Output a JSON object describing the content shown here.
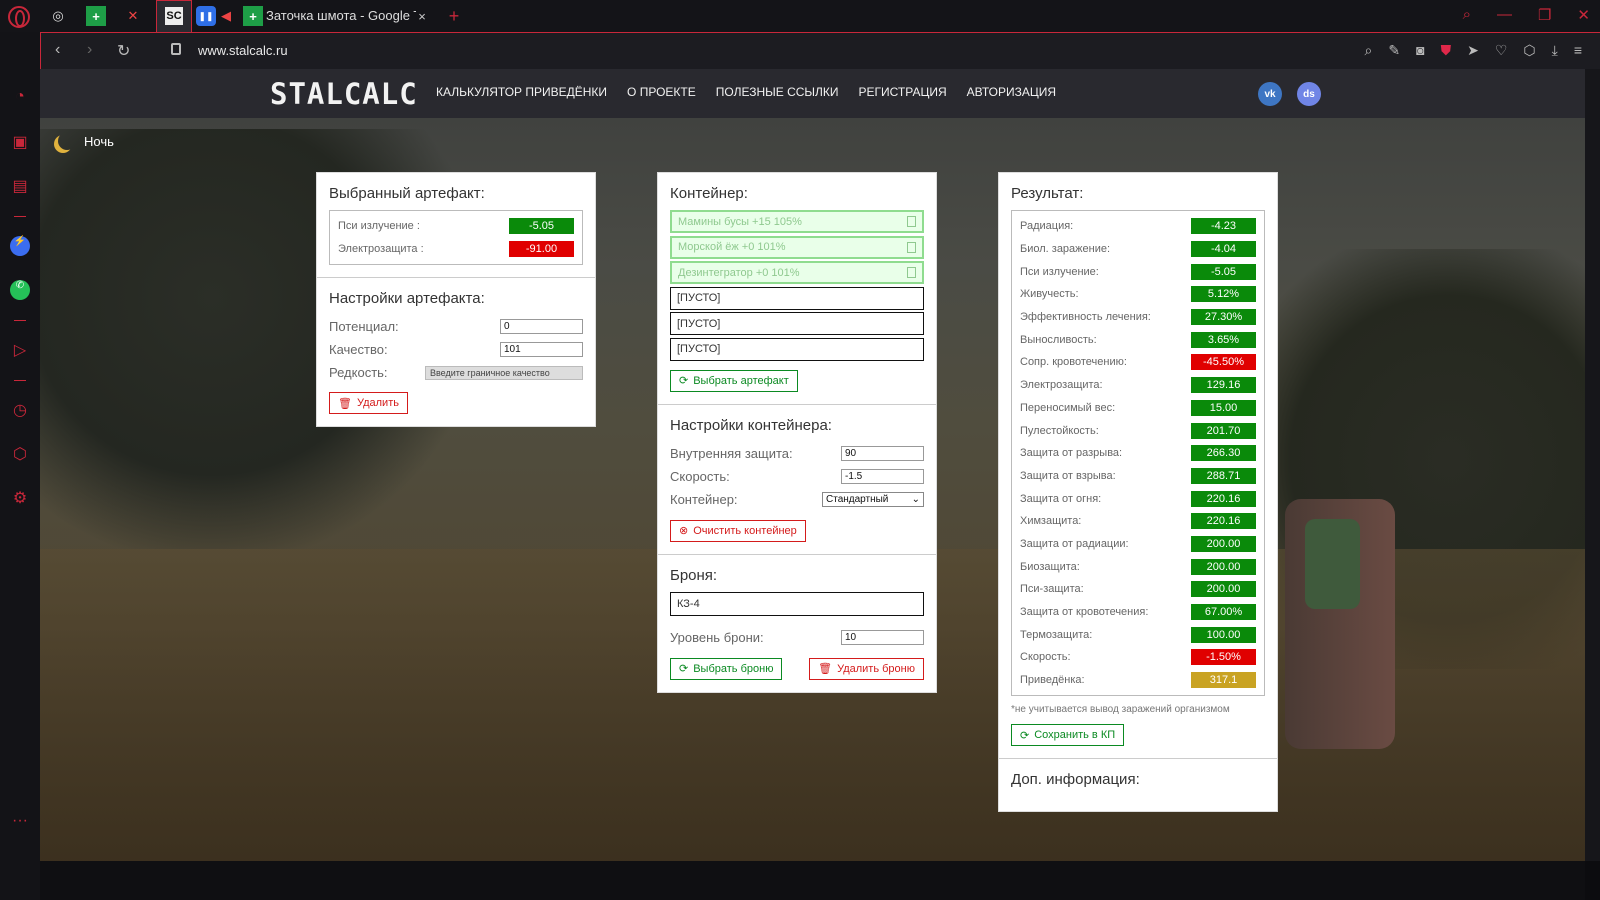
{
  "browser": {
    "tab_title": "Заточка шмота - Google T",
    "url": "www.stalcalc.ru",
    "new_tab_glyph": "+",
    "close_tab_glyph": "×",
    "tab_logo_text": "SC"
  },
  "site": {
    "brand": "STALCALC",
    "nav": [
      "КАЛЬКУЛЯТОР ПРИВЕДЁНКИ",
      "О ПРОЕКТЕ",
      "ПОЛЕЗНЫЕ ССЫЛКИ",
      "РЕГИСТРАЦИЯ",
      "АВТОРИЗАЦИЯ"
    ],
    "vk_label": "vk",
    "discord_label": "ds",
    "night_label": "Ночь"
  },
  "artifact": {
    "title": "Выбранный артефакт:",
    "stats": [
      {
        "label": "Пси излучение :",
        "value": "-5.05",
        "color": "green"
      },
      {
        "label": "Электрозащита :",
        "value": "-91.00",
        "color": "red"
      }
    ],
    "settings_title": "Настройки артефакта:",
    "potential_label": "Потенциал:",
    "potential_value": "0",
    "quality_label": "Качество:",
    "quality_value": "101",
    "rarity_label": "Редкость:",
    "rarity_placeholder": "Введите граничное качество",
    "delete_label": "Удалить"
  },
  "container": {
    "title": "Контейнер:",
    "slots": [
      {
        "text": "Мамины бусы +15 105%",
        "filled": true
      },
      {
        "text": "Морской ёж +0 101%",
        "filled": true
      },
      {
        "text": "Дезинтегратор +0 101%",
        "filled": true
      },
      {
        "text": "[ПУСТО]",
        "filled": false
      },
      {
        "text": "[ПУСТО]",
        "filled": false
      },
      {
        "text": "[ПУСТО]",
        "filled": false
      }
    ],
    "choose_artifact_label": "Выбрать артефакт",
    "settings_title": "Настройки контейнера:",
    "inner_protection_label": "Внутренняя защита:",
    "inner_protection_value": "90",
    "speed_label": "Скорость:",
    "speed_value": "-1.5",
    "container_label": "Контейнер:",
    "container_value": "Стандартный",
    "clear_label": "Очистить контейнер",
    "armor_title": "Броня:",
    "armor_value": "КЗ-4",
    "armor_level_label": "Уровень брони:",
    "armor_level_value": "10",
    "choose_armor_label": "Выбрать броню",
    "delete_armor_label": "Удалить броню"
  },
  "result": {
    "title": "Результат:",
    "rows": [
      {
        "label": "Радиация:",
        "value": "-4.23",
        "color": "green"
      },
      {
        "label": "Биол. заражение:",
        "value": "-4.04",
        "color": "green"
      },
      {
        "label": "Пси излучение:",
        "value": "-5.05",
        "color": "green"
      },
      {
        "label": "Живучесть:",
        "value": "5.12%",
        "color": "green"
      },
      {
        "label": "Эффективность лечения:",
        "value": "27.30%",
        "color": "green"
      },
      {
        "label": "Выносливость:",
        "value": "3.65%",
        "color": "green"
      },
      {
        "label": "Сопр. кровотечению:",
        "value": "-45.50%",
        "color": "red"
      },
      {
        "label": "Электрозащита:",
        "value": "129.16",
        "color": "green"
      },
      {
        "label": "Переносимый вес:",
        "value": "15.00",
        "color": "green"
      },
      {
        "label": "Пулестойкость:",
        "value": "201.70",
        "color": "green"
      },
      {
        "label": "Защита от разрыва:",
        "value": "266.30",
        "color": "green"
      },
      {
        "label": "Защита от взрыва:",
        "value": "288.71",
        "color": "green"
      },
      {
        "label": "Защита от огня:",
        "value": "220.16",
        "color": "green"
      },
      {
        "label": "Химзащита:",
        "value": "220.16",
        "color": "green"
      },
      {
        "label": "Защита от радиации:",
        "value": "200.00",
        "color": "green"
      },
      {
        "label": "Биозащита:",
        "value": "200.00",
        "color": "green"
      },
      {
        "label": "Пси-защита:",
        "value": "200.00",
        "color": "green"
      },
      {
        "label": "Защита от кровотечения:",
        "value": "67.00%",
        "color": "green"
      },
      {
        "label": "Термозащита:",
        "value": "100.00",
        "color": "green"
      },
      {
        "label": "Скорость:",
        "value": "-1.50%",
        "color": "red"
      },
      {
        "label": "Приведёнка:",
        "value": "317.1",
        "color": "gold"
      }
    ],
    "note": "*не учитывается вывод заражений организмом",
    "save_label": "Сохранить в КП",
    "extra_title": "Доп. информация:"
  },
  "colors": {
    "green": "#0a8a0a",
    "red": "#e00000",
    "gold": "#c9a323",
    "accent": "#c8273a"
  }
}
